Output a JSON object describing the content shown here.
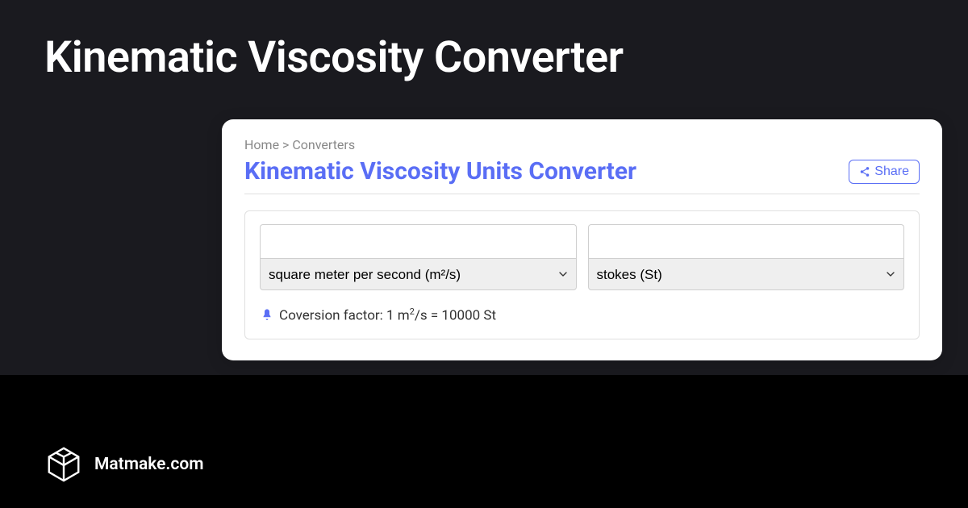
{
  "page": {
    "title": "Kinematic Viscosity Converter"
  },
  "breadcrumb": {
    "home": "Home",
    "separator": ">",
    "current": "Converters"
  },
  "card": {
    "title": "Kinematic Viscosity Units Converter",
    "share_label": "Share"
  },
  "converter": {
    "input_left_value": "",
    "input_right_value": "",
    "unit_left": "square meter per second (m²/s)",
    "unit_right": "stokes (St)",
    "factor_prefix": "Coversion factor: 1 m",
    "factor_sup": "2",
    "factor_suffix": "/s = 10000 St"
  },
  "footer": {
    "brand": "Matmake.com"
  }
}
